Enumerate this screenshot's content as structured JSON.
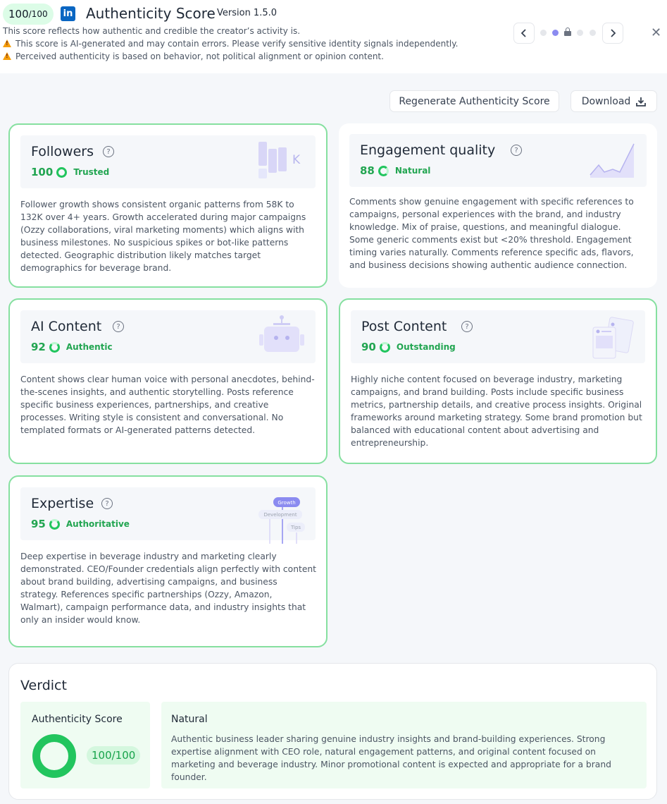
{
  "header": {
    "score_value": "100",
    "score_denominator": "/100",
    "platform_icon": "linkedin-icon",
    "title": "Authenticity Score",
    "version": "Version 1.5.0",
    "description": "This score reflects how authentic and credible the creator’s activity is.",
    "warnings": [
      "This score is AI-generated and may contain errors. Please verify sensitive identity signals independently.",
      "Perceived authenticity is based on behavior, not political alignment or opinion content."
    ],
    "close_icon": "close-icon"
  },
  "pager": {
    "prev_icon": "chevron-left-icon",
    "next_icon": "chevron-right-icon",
    "dot_count": 5,
    "active_index": 1,
    "locked_index": 2
  },
  "actions": {
    "regenerate_label": "Regenerate Authenticity Score",
    "download_label": "Download",
    "download_icon": "download-icon"
  },
  "cards": {
    "followers": {
      "title": "Followers",
      "score": "100",
      "label": "Trusted",
      "illus_letter": "K",
      "body": "Follower growth shows consistent organic patterns from 58K to 132K over 4+ years. Growth accelerated during major campaigns (Ozzy collaborations, viral marketing moments) which aligns with business milestones. No suspicious spikes or bot-like patterns detected. Geographic distribution likely matches target demographics for beverage brand."
    },
    "engagement": {
      "title": "Engagement quality",
      "score": "88",
      "label": "Natural",
      "body": "Comments show genuine engagement with specific references to campaigns, personal experiences with the brand, and industry knowledge. Mix of praise, questions, and meaningful dialogue. Some generic comments exist but <20% threshold. Engagement timing varies naturally. Comments reference specific ads, flavors, and business decisions showing authentic audience connection."
    },
    "ai_content": {
      "title": "AI Content",
      "score": "92",
      "label": "Authentic",
      "body": "Content shows clear human voice with personal anecdotes, behind-the-scenes insights, and authentic storytelling. Posts reference specific business experiences, partnerships, and creative processes. Writing style is consistent and conversational. No templated formats or AI-generated patterns detected."
    },
    "post_content": {
      "title": "Post Content",
      "score": "90",
      "label": "Outstanding",
      "body": "Highly niche content focused on beverage industry, marketing campaigns, and brand building. Posts include specific business metrics, partnership details, and creative process insights. Original frameworks around marketing strategy. Some brand promotion but balanced with educational content about advertising and entrepreneurship."
    },
    "expertise": {
      "title": "Expertise",
      "score": "95",
      "label": "Authoritative",
      "illus_tags": [
        "Growth",
        "Development",
        "Tips"
      ],
      "body": "Deep expertise in beverage industry and marketing clearly demonstrated. CEO/Founder credentials align perfectly with content about brand building, advertising campaigns, and business strategy. References specific partnerships (Ozzy, Amazon, Walmart), campaign performance data, and industry insights that only an insider would know."
    }
  },
  "verdict": {
    "title": "Verdict",
    "score_label": "Authenticity Score",
    "score_value": "100/100",
    "score_fraction": 1.0,
    "heading": "Natural",
    "body": "Authentic business leader sharing genuine industry insights and brand-building experiences. Strong expertise alignment with CEO role, natural engagement patterns, and original content focused on marketing and beverage industry. Minor promotional content is expected and appropriate for a brand founder."
  },
  "colors": {
    "accent_green": "#22c55e",
    "pill_green_bg": "#dcfce7",
    "card_border": "#86e0a0",
    "linkedin_blue": "#0a66c2",
    "pager_active": "#8b8bf0",
    "warning": "#f59e0b"
  }
}
